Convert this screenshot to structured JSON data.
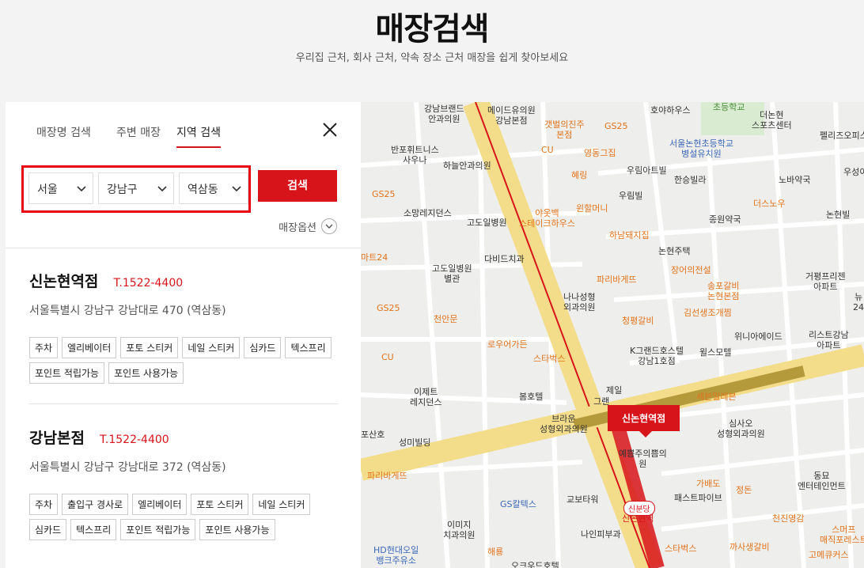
{
  "header": {
    "title": "매장검색",
    "subtitle": "우리집 근처, 회사 근처, 약속 장소 근처 매장을 쉽게 찾아보세요"
  },
  "tabs": [
    {
      "label": "매장명 검색",
      "active": false
    },
    {
      "label": "주변 매장",
      "active": false
    },
    {
      "label": "지역 검색",
      "active": true
    }
  ],
  "filters": {
    "city": "서울",
    "district": "강남구",
    "dong": "역삼동",
    "search_label": "검색",
    "options_label": "매장옵션"
  },
  "stores": [
    {
      "name": "신논현역점",
      "phone": "T.1522-4400",
      "address": "서울특별시 강남구 강남대로 470 (역삼동)",
      "tags": [
        "주차",
        "엘리베이터",
        "포토 스티커",
        "네일 스티커",
        "심카드",
        "텍스프리",
        "포인트 적립가능",
        "포인트 사용가능"
      ]
    },
    {
      "name": "강남본점",
      "phone": "T.1522-4400",
      "address": "서울특별시 강남구 강남대로 372 (역삼동)",
      "tags": [
        "주차",
        "출입구 경사로",
        "엘리베이터",
        "포토 스티커",
        "네일 스티커",
        "심카드",
        "텍스프리",
        "포인트 적립가능",
        "포인트 사용가능"
      ]
    }
  ],
  "map": {
    "marker_label": "신논현역점",
    "station_label": "신분당",
    "labels": {
      "l1": "강남브랜드\n안과의원",
      "l2": "메이드유의원\n강남본점",
      "l3": "갯벌의진주\n본점",
      "l4": "GS25",
      "l5": "호야하우스",
      "l6": "초등학교",
      "l7": "더논현\n스포츠센터",
      "l8": "펠리즈오피스",
      "l9": "반포휘트니스\n사우나",
      "l10": "하늘안과의원",
      "l11": "CU",
      "l12": "영동그집",
      "l13": "서울논현초등학교\n병설유치원",
      "l14": "우성이",
      "l15": "우림아트빌",
      "l16": "한승빌라",
      "l17": "노바약국",
      "l18": "GS25",
      "l19": "혜링",
      "l20": "우림빌",
      "l21": "소망레지던스",
      "l22": "고도일병원",
      "l23": "야옷백\n스테이크하우스",
      "l24": "윈할머니",
      "l25": "더스노우",
      "l26": "종원약국",
      "l27": "논현빌",
      "l28": "하남돼지집",
      "l29": "마트24",
      "l30": "다비드치과",
      "l31": "논현주택",
      "l32": "고도일병원\n별관",
      "l33": "파리바게뜨",
      "l34": "장어의전설",
      "l35": "거평프리젠\n아파트",
      "l36": "GS25",
      "l37": "나나성형\n외과의원",
      "l38": "송포갈비\n논현본점",
      "l39": "뉴\n24",
      "l40": "천안문",
      "l41": "청평갈비",
      "l42": "김선생조개찜",
      "l43": "위니아에이드",
      "l44": "리스트강남\n아파트",
      "l45": "로우어가든",
      "l46": "K그랜드호스텔\n강남1호점",
      "l47": "윌스모텔",
      "l48": "CU",
      "l49": "스타벅스",
      "l50": "제일",
      "l51": "이제트\n레지던스",
      "l52": "봄호텔",
      "l53": "그랜",
      "l54": "세븐일레븐",
      "l55": "브라운\n성형외과의원",
      "l56": "심사오\n성형외과의원",
      "l57": "포산호",
      "l58": "성미빌딩",
      "l59": "예쁨주의쁨의\n원",
      "l60": "파리바게뜨",
      "l61": "가배도",
      "l62": "정돈",
      "l63": "동묘\n엔터테인먼트",
      "l64": "GS칼텍스",
      "l65": "교보타워",
      "l66": "패스트파이브",
      "l67": "신논현역",
      "l68": "이미지\n치과의원",
      "l69": "나인피부과",
      "l70": "천진영감",
      "l71": "스머프\n매직포레스트",
      "l72": "HD현대오일\n뱅크주유소",
      "l73": "해룡",
      "l74": "스타벅스",
      "l75": "까사생갈비",
      "l76": "고메큐커스",
      "l77": "오크우드호텔"
    }
  }
}
